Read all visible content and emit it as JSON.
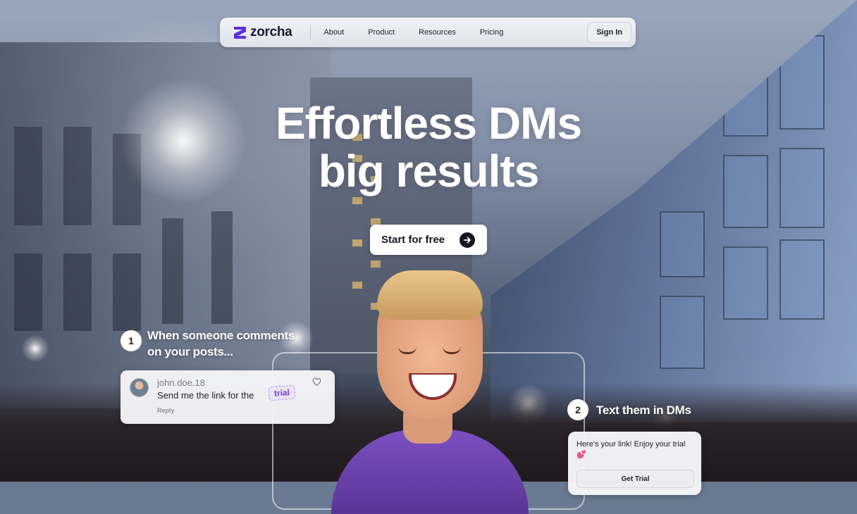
{
  "nav": {
    "brand": "zorcha",
    "links": [
      "About",
      "Product",
      "Resources",
      "Pricing"
    ],
    "signin": "Sign In",
    "brand_color": "#5b2ee6"
  },
  "hero": {
    "line1": "Effortless DMs",
    "line2": "big results",
    "cta": "Start for free"
  },
  "steps": [
    {
      "number": "1",
      "line1": "When someone comments",
      "line2": "on your posts..."
    },
    {
      "number": "2",
      "line1": "Text them in DMs"
    }
  ],
  "comment": {
    "username": "john.doe.18",
    "text": "Send me the link for the",
    "tag": "trial",
    "reply": "Reply"
  },
  "dm": {
    "text": "Here's your link! Enjoy your trial 💕",
    "button": "Get Trial"
  },
  "icons": {
    "cta_arrow": "arrow-right-icon",
    "like": "heart-icon",
    "logo": "zorcha-logo-icon"
  }
}
